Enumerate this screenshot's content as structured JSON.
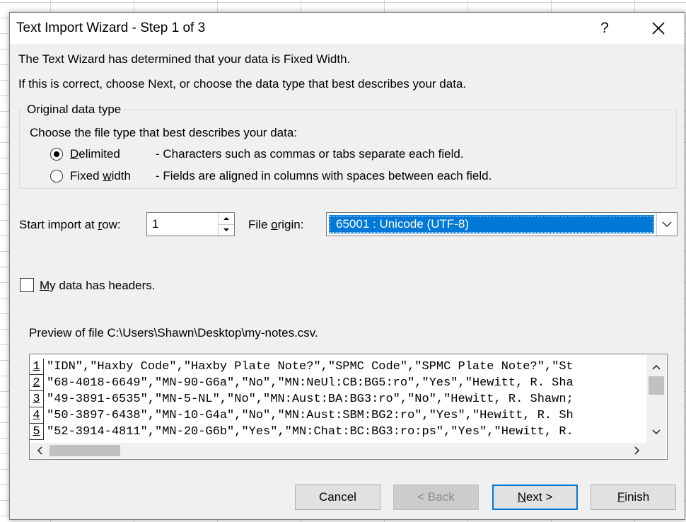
{
  "dialog": {
    "title": "Text Import Wizard - Step 1 of 3",
    "help_label": "?",
    "line1": "The Text Wizard has determined that your data is Fixed Width.",
    "line2": "If this is correct, choose Next, or choose the data type that best describes your data."
  },
  "original_data_type": {
    "legend": "Original data type",
    "description": "Choose the file type that best describes your data:",
    "options": [
      {
        "label_pre": "",
        "label_key": "D",
        "label_post": "elimited",
        "description": "- Characters such as commas or tabs separate each field.",
        "selected": true
      },
      {
        "label_pre": "Fixed ",
        "label_key": "w",
        "label_post": "idth",
        "description": "- Fields are aligned in columns with spaces between each field.",
        "selected": false
      }
    ]
  },
  "import": {
    "start_label_pre": "Start import at ",
    "start_label_key": "r",
    "start_label_post": "ow:",
    "start_row": "1",
    "origin_label_pre": "File ",
    "origin_label_key": "o",
    "origin_label_post": "rigin:",
    "origin_value": "65001 : Unicode (UTF-8)"
  },
  "headers_checkbox": {
    "label_key": "M",
    "label_post": "y data has headers.",
    "checked": false
  },
  "preview": {
    "label": "Preview of file C:\\Users\\Shawn\\Desktop\\my-notes.csv.",
    "rows": [
      {
        "num": "1",
        "text": "\"IDN\",\"Haxby Code\",\"Haxby Plate Note?\",\"SPMC Code\",\"SPMC Plate Note?\",\"St"
      },
      {
        "num": "2",
        "text": "\"68-4018-6649\",\"MN-90-G6a\",\"No\",\"MN:NeUl:CB:BG5:ro\",\"Yes\",\"Hewitt, R. Sha"
      },
      {
        "num": "3",
        "text": "\"49-3891-6535\",\"MN-5-NL\",\"No\",\"MN:Aust:BA:BG3:ro\",\"No\",\"Hewitt, R. Shawn;"
      },
      {
        "num": "4",
        "text": "\"50-3897-6438\",\"MN-10-G4a\",\"No\",\"MN:Aust:SBM:BG2:ro\",\"Yes\",\"Hewitt, R. Sh"
      },
      {
        "num": "5",
        "text": "\"52-3914-4811\",\"MN-20-G6b\",\"Yes\",\"MN:Chat:BC:BG3:ro:ps\",\"Yes\",\"Hewitt, R."
      }
    ]
  },
  "buttons": {
    "cancel": "Cancel",
    "back": "< Back",
    "next_key": "N",
    "next_post": "ext >",
    "finish_key": "F",
    "finish_post": "inish"
  },
  "colors": {
    "accent": "#0078d7",
    "dialog_bg": "#f0f0f0"
  },
  "icons": [
    "close-icon",
    "spin-up-icon",
    "spin-down-icon",
    "chevron-down-icon",
    "scroll-up-icon",
    "scroll-down-icon",
    "scroll-left-icon",
    "scroll-right-icon"
  ]
}
